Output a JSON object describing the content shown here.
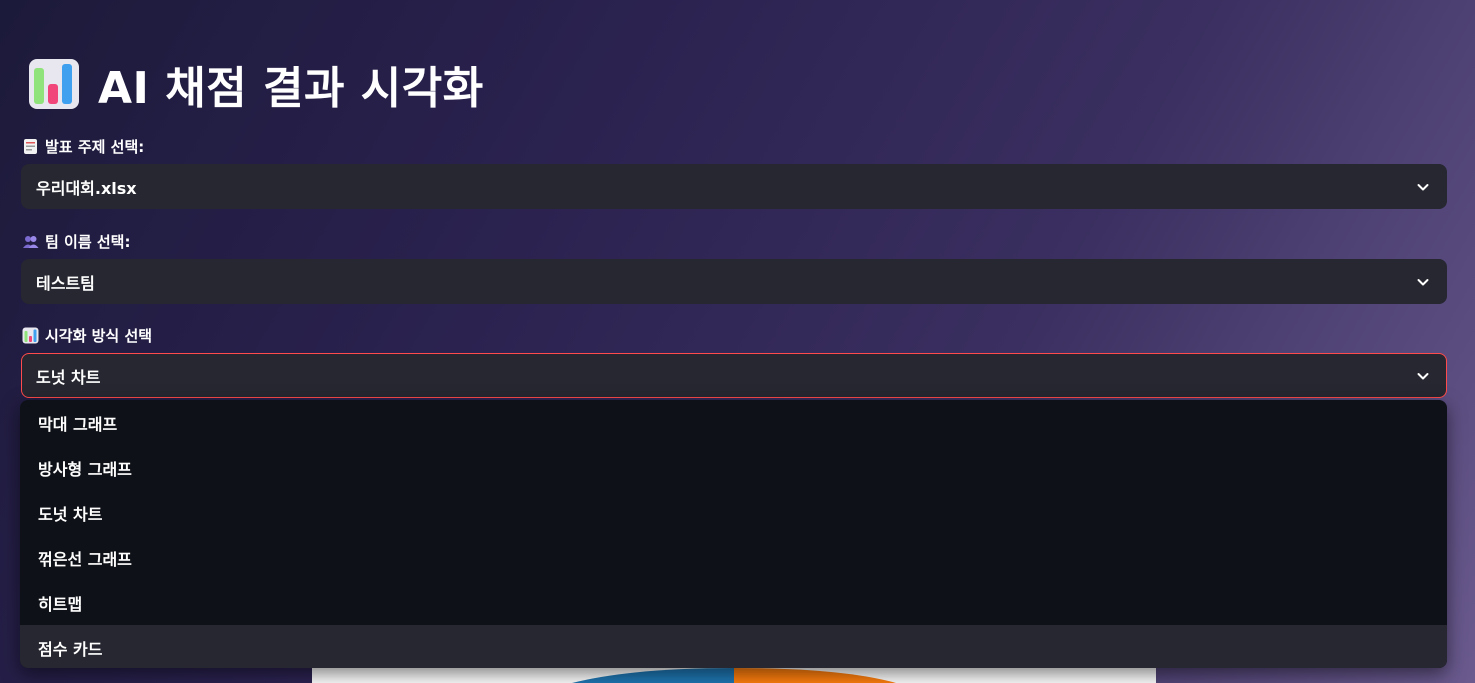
{
  "app": {
    "title": "AI 채점 결과 시각화",
    "title_icon": "bar-chart-icon"
  },
  "fields": {
    "topic": {
      "label": "발표 주제 선택:",
      "icon": "memo-icon",
      "value": "우리대회.xlsx"
    },
    "team": {
      "label": "팀 이름 선택:",
      "icon": "people-icon",
      "value": "테스트팀"
    },
    "viz": {
      "label": "시각화 방식 선택",
      "icon": "bar-chart-icon",
      "value": "도넛 차트",
      "options": [
        "막대 그래프",
        "방사형 그래프",
        "도넛 차트",
        "꺾은선 그래프",
        "히트맵",
        "점수 카드"
      ],
      "hovered_option": "점수 카드"
    }
  },
  "colors": {
    "select_bg": "#262730",
    "menu_bg": "#0e1117",
    "focus_border": "#ff4b4b",
    "donut_blue": "#1f77b4",
    "donut_orange": "#ff7f0e"
  }
}
